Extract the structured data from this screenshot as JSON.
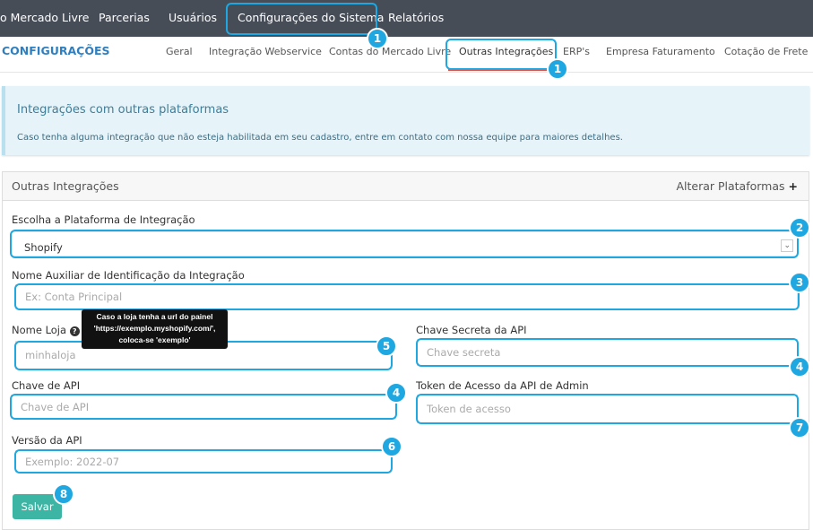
{
  "topnav": {
    "items": [
      "o Mercado Livre",
      "Parcerias",
      "Usuários",
      "Configurações do Sistema",
      "Relatórios"
    ]
  },
  "subnav": {
    "brand": "CONFIGURAÇÕES",
    "tabs": [
      "Geral",
      "Integração Webservice",
      "Contas do Mercado Livre",
      "Outras Integrações",
      "ERP's",
      "Empresa Faturamento",
      "Cotação de Frete"
    ],
    "active": "Outras Integrações"
  },
  "info": {
    "title": "Integrações com outras plataformas",
    "text": "Caso tenha alguma integração que não esteja habilitada em seu cadastro, entre em contato com nossa equipe para maiores detalhes."
  },
  "panel": {
    "title": "Outras Integrações",
    "action": "Alterar Plataformas",
    "action_icon": "plus-icon"
  },
  "form": {
    "platform_label": "Escolha a Plataforma de Integração",
    "platform_value": "Shopify",
    "aux_label": "Nome Auxiliar de Identificação da Integração",
    "aux_placeholder": "Ex: Conta Principal",
    "store_label": "Nome Loja",
    "store_placeholder": "minhaloja",
    "tooltip": "Caso a loja tenha a url do painel 'https://exemplo.myshopify.com/', coloca-se 'exemplo'",
    "secret_label": "Chave Secreta da API",
    "secret_placeholder": "Chave secreta",
    "apikey_label": "Chave de API",
    "apikey_placeholder": "Chave de API",
    "token_label": "Token de Acesso da API de Admin",
    "token_placeholder": "Token de acesso",
    "version_label": "Versão da API",
    "version_placeholder": "Exemplo: 2022-07",
    "save": "Salvar"
  },
  "badges": [
    "1",
    "1",
    "2",
    "3",
    "5",
    "4",
    "4",
    "7",
    "6",
    "8"
  ],
  "colors": {
    "nav": "#474d57",
    "accent": "#1ea7e0",
    "save": "#3cb5a4",
    "brand": "#2f7fc0"
  }
}
